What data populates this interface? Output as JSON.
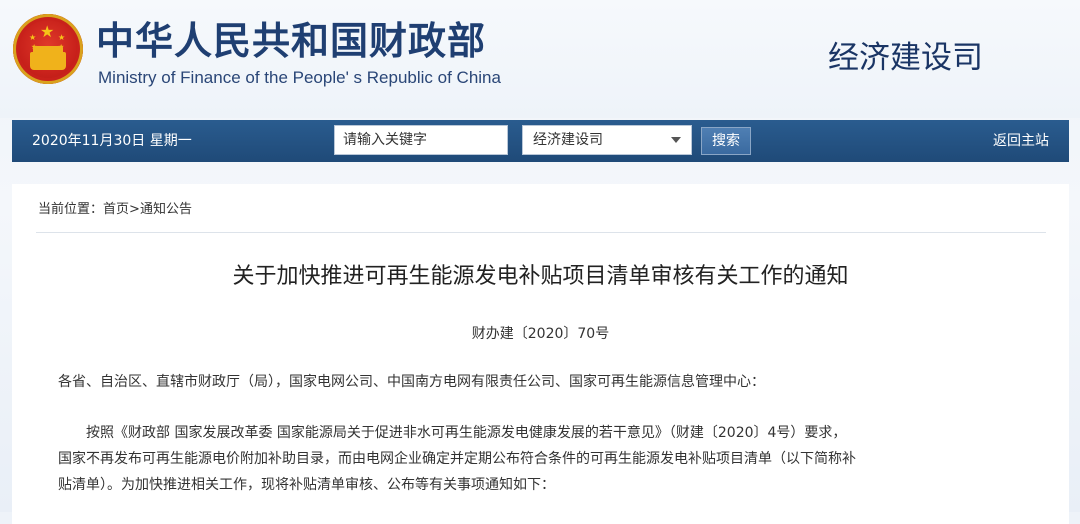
{
  "header": {
    "title_cn": "中华人民共和国财政部",
    "title_en": "Ministry of Finance of the People' s Republic of China",
    "department": "经济建设司"
  },
  "navbar": {
    "date": "2020年11月30日  星期一",
    "search_placeholder": "请输入关键字",
    "department_select": "经济建设司",
    "search_button": "搜索",
    "home_link": "返回主站"
  },
  "breadcrumb": {
    "prefix": "当前位置：",
    "home": "首页",
    "separator": ">",
    "section": "通知公告"
  },
  "article": {
    "title": "关于加快推进可再生能源发电补贴项目清单审核有关工作的通知",
    "doc_number": "财办建〔2020〕70号",
    "addressee": "各省、自治区、直辖市财政厅（局），国家电网公司、中国南方电网有限责任公司、国家可再生能源信息管理中心：",
    "paragraph_lines": [
      "按照《财政部  国家发展改革委  国家能源局关于促进非水可再生能源发电健康发展的若干意见》（财建〔2020〕4号）要求，",
      "国家不再发布可再生能源电价附加补助目录，而由电网企业确定并定期公布符合条件的可再生能源发电补贴项目清单（以下简称补",
      "贴清单）。为加快推进相关工作，现将补贴清单审核、公布等有关事项通知如下："
    ]
  },
  "colors": {
    "navbar": "#24538a",
    "title_blue": "#1f3f72",
    "emblem_red": "#c8211b",
    "emblem_gold": "#f5c518"
  }
}
